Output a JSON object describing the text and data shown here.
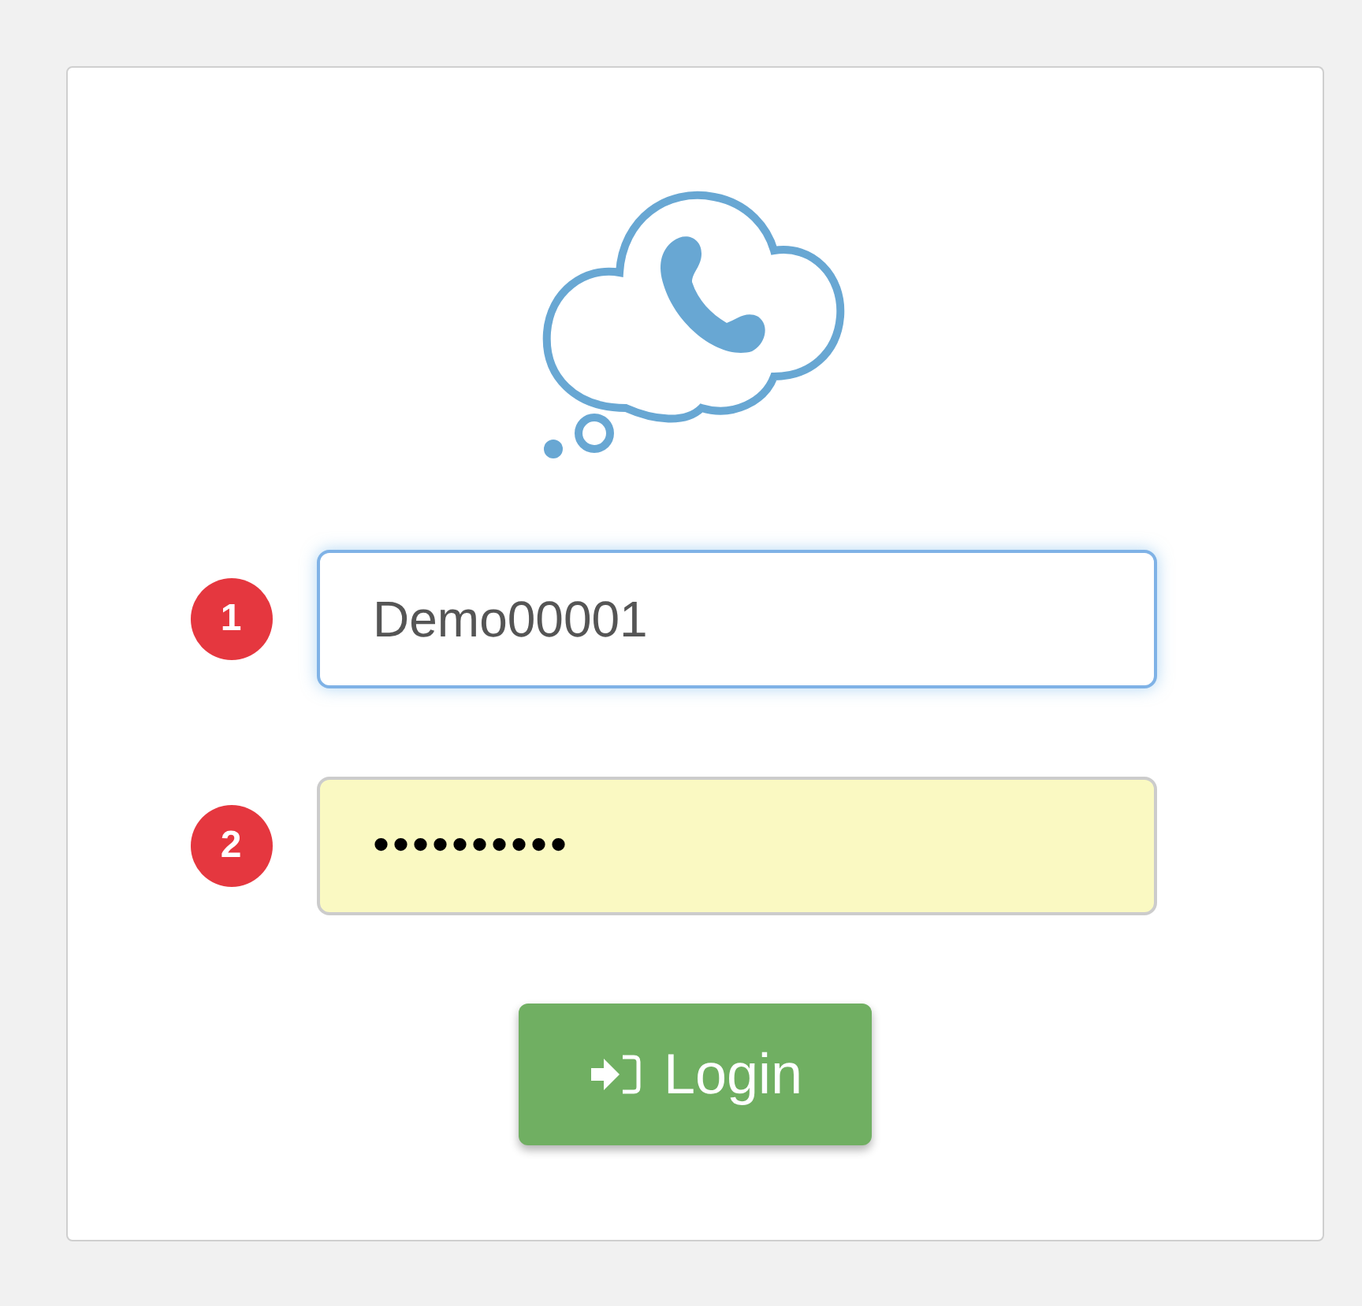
{
  "login_form": {
    "fields": [
      {
        "step": "1",
        "kind": "text",
        "value": "Demo00001",
        "focused": true,
        "autofilled": false
      },
      {
        "step": "2",
        "kind": "password",
        "value": "••••••••••",
        "focused": false,
        "autofilled": true
      }
    ],
    "submit_button": {
      "label": "Login"
    }
  }
}
